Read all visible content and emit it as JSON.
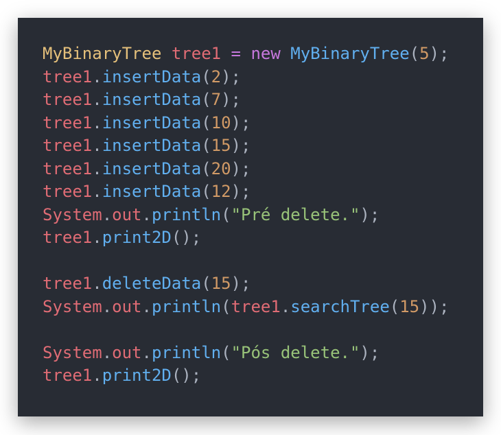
{
  "theme_colors": {
    "background": "#282c34",
    "type": "#e5c07b",
    "variable": "#e06c75",
    "keyword": "#c678dd",
    "function": "#61afef",
    "number": "#d19a66",
    "string": "#98c379",
    "punctuation": "#abb2bf"
  },
  "code_lines": [
    [
      {
        "t": "MyBinaryTree",
        "c": "type"
      },
      {
        "t": " ",
        "c": "punc"
      },
      {
        "t": "tree1",
        "c": "var"
      },
      {
        "t": " ",
        "c": "punc"
      },
      {
        "t": "=",
        "c": "kw"
      },
      {
        "t": " ",
        "c": "punc"
      },
      {
        "t": "new",
        "c": "kw"
      },
      {
        "t": " ",
        "c": "punc"
      },
      {
        "t": "MyBinaryTree",
        "c": "fn"
      },
      {
        "t": "(",
        "c": "punc"
      },
      {
        "t": "5",
        "c": "num"
      },
      {
        "t": ");",
        "c": "punc"
      }
    ],
    [
      {
        "t": "tree1",
        "c": "var"
      },
      {
        "t": ".",
        "c": "punc"
      },
      {
        "t": "insertData",
        "c": "fn"
      },
      {
        "t": "(",
        "c": "punc"
      },
      {
        "t": "2",
        "c": "num"
      },
      {
        "t": ");",
        "c": "punc"
      }
    ],
    [
      {
        "t": "tree1",
        "c": "var"
      },
      {
        "t": ".",
        "c": "punc"
      },
      {
        "t": "insertData",
        "c": "fn"
      },
      {
        "t": "(",
        "c": "punc"
      },
      {
        "t": "7",
        "c": "num"
      },
      {
        "t": ");",
        "c": "punc"
      }
    ],
    [
      {
        "t": "tree1",
        "c": "var"
      },
      {
        "t": ".",
        "c": "punc"
      },
      {
        "t": "insertData",
        "c": "fn"
      },
      {
        "t": "(",
        "c": "punc"
      },
      {
        "t": "10",
        "c": "num"
      },
      {
        "t": ");",
        "c": "punc"
      }
    ],
    [
      {
        "t": "tree1",
        "c": "var"
      },
      {
        "t": ".",
        "c": "punc"
      },
      {
        "t": "insertData",
        "c": "fn"
      },
      {
        "t": "(",
        "c": "punc"
      },
      {
        "t": "15",
        "c": "num"
      },
      {
        "t": ");",
        "c": "punc"
      }
    ],
    [
      {
        "t": "tree1",
        "c": "var"
      },
      {
        "t": ".",
        "c": "punc"
      },
      {
        "t": "insertData",
        "c": "fn"
      },
      {
        "t": "(",
        "c": "punc"
      },
      {
        "t": "20",
        "c": "num"
      },
      {
        "t": ");",
        "c": "punc"
      }
    ],
    [
      {
        "t": "tree1",
        "c": "var"
      },
      {
        "t": ".",
        "c": "punc"
      },
      {
        "t": "insertData",
        "c": "fn"
      },
      {
        "t": "(",
        "c": "punc"
      },
      {
        "t": "12",
        "c": "num"
      },
      {
        "t": ");",
        "c": "punc"
      }
    ],
    [
      {
        "t": "System",
        "c": "var"
      },
      {
        "t": ".",
        "c": "punc"
      },
      {
        "t": "out",
        "c": "var"
      },
      {
        "t": ".",
        "c": "punc"
      },
      {
        "t": "println",
        "c": "fn"
      },
      {
        "t": "(",
        "c": "punc"
      },
      {
        "t": "\"Pré delete.\"",
        "c": "str"
      },
      {
        "t": ");",
        "c": "punc"
      }
    ],
    [
      {
        "t": "tree1",
        "c": "var"
      },
      {
        "t": ".",
        "c": "punc"
      },
      {
        "t": "print2D",
        "c": "fn"
      },
      {
        "t": "();",
        "c": "punc"
      }
    ],
    [],
    [
      {
        "t": "tree1",
        "c": "var"
      },
      {
        "t": ".",
        "c": "punc"
      },
      {
        "t": "deleteData",
        "c": "fn"
      },
      {
        "t": "(",
        "c": "punc"
      },
      {
        "t": "15",
        "c": "num"
      },
      {
        "t": ");",
        "c": "punc"
      }
    ],
    [
      {
        "t": "System",
        "c": "var"
      },
      {
        "t": ".",
        "c": "punc"
      },
      {
        "t": "out",
        "c": "var"
      },
      {
        "t": ".",
        "c": "punc"
      },
      {
        "t": "println",
        "c": "fn"
      },
      {
        "t": "(",
        "c": "punc"
      },
      {
        "t": "tree1",
        "c": "var"
      },
      {
        "t": ".",
        "c": "punc"
      },
      {
        "t": "searchTree",
        "c": "fn"
      },
      {
        "t": "(",
        "c": "punc"
      },
      {
        "t": "15",
        "c": "num"
      },
      {
        "t": "));",
        "c": "punc"
      }
    ],
    [],
    [
      {
        "t": "System",
        "c": "var"
      },
      {
        "t": ".",
        "c": "punc"
      },
      {
        "t": "out",
        "c": "var"
      },
      {
        "t": ".",
        "c": "punc"
      },
      {
        "t": "println",
        "c": "fn"
      },
      {
        "t": "(",
        "c": "punc"
      },
      {
        "t": "\"Pós delete.\"",
        "c": "str"
      },
      {
        "t": ");",
        "c": "punc"
      }
    ],
    [
      {
        "t": "tree1",
        "c": "var"
      },
      {
        "t": ".",
        "c": "punc"
      },
      {
        "t": "print2D",
        "c": "fn"
      },
      {
        "t": "();",
        "c": "punc"
      }
    ]
  ]
}
